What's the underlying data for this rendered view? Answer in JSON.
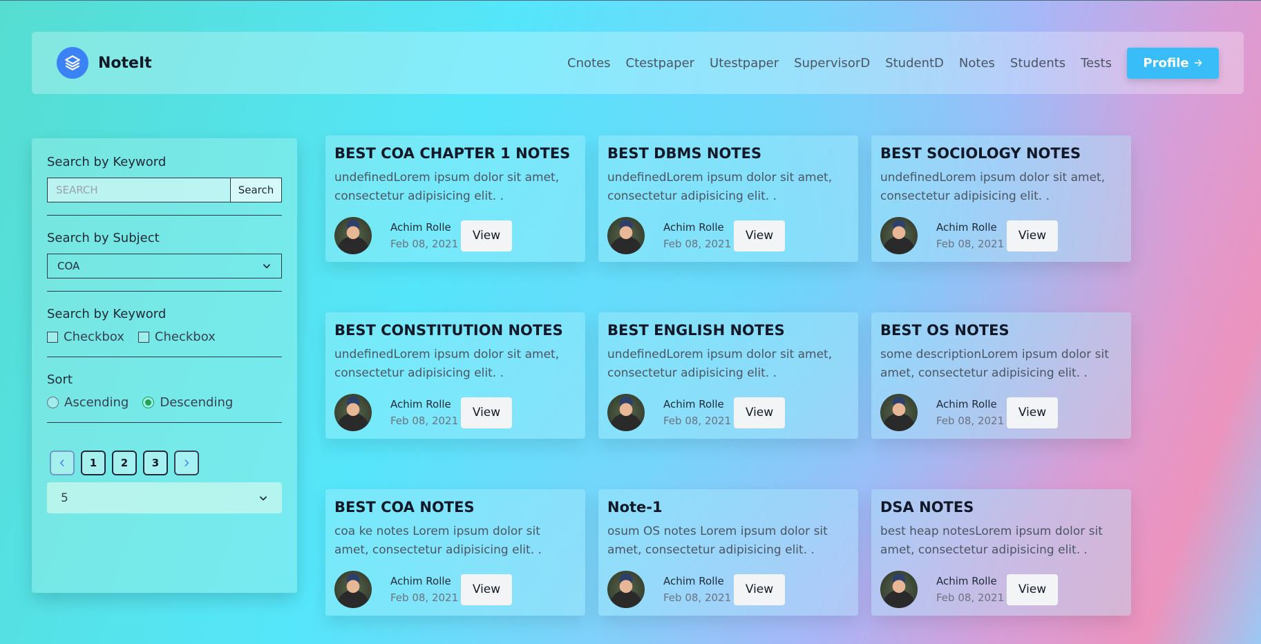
{
  "app": {
    "name": "NoteIt",
    "logo_icon": "layers-icon"
  },
  "nav": {
    "links": [
      "Cnotes",
      "Ctestpaper",
      "Utestpaper",
      "SupervisorD",
      "StudentD",
      "Notes",
      "Students",
      "Tests"
    ],
    "profile_label": "Profile",
    "profile_icon": "arrow-right-icon"
  },
  "sidebar": {
    "keyword": {
      "title": "Search by Keyword",
      "placeholder": "SEARCH",
      "value": "",
      "button": "Search"
    },
    "subject": {
      "title": "Search by Subject",
      "selected": "COA"
    },
    "keyword2": {
      "title": "Search by Keyword",
      "checkboxes": [
        "Checkbox",
        "Checkbox"
      ]
    },
    "sort": {
      "title": "Sort",
      "options": [
        "Ascending",
        "Descending"
      ],
      "selected": "Descending"
    },
    "pagination": {
      "pages": [
        "1",
        "2",
        "3"
      ]
    },
    "per_page": "5"
  },
  "colors": {
    "primary": "#38bdf8",
    "logo": "#3b82f6",
    "radio_checked": "#22a354"
  },
  "cards": [
    {
      "title": "BEST COA CHAPTER 1 NOTES",
      "desc": "undefinedLorem ipsum dolor sit amet, consectetur adipisicing elit. .",
      "author": "Achim Rolle",
      "date": "Feb 08, 2021",
      "button": "View"
    },
    {
      "title": "BEST DBMS NOTES",
      "desc": "undefinedLorem ipsum dolor sit amet, consectetur adipisicing elit. .",
      "author": "Achim Rolle",
      "date": "Feb 08, 2021",
      "button": "View"
    },
    {
      "title": "BEST SOCIOLOGY NOTES",
      "desc": "undefinedLorem ipsum dolor sit amet, consectetur adipisicing elit. .",
      "author": "Achim Rolle",
      "date": "Feb 08, 2021",
      "button": "View"
    },
    {
      "title": "BEST CONSTITUTION NOTES",
      "desc": "undefinedLorem ipsum dolor sit amet, consectetur adipisicing elit. .",
      "author": "Achim Rolle",
      "date": "Feb 08, 2021",
      "button": "View"
    },
    {
      "title": "BEST ENGLISH NOTES",
      "desc": "undefinedLorem ipsum dolor sit amet, consectetur adipisicing elit. .",
      "author": "Achim Rolle",
      "date": "Feb 08, 2021",
      "button": "View"
    },
    {
      "title": "BEST OS NOTES",
      "desc": "some descriptionLorem ipsum dolor sit amet, consectetur adipisicing elit. .",
      "author": "Achim Rolle",
      "date": "Feb 08, 2021",
      "button": "View"
    },
    {
      "title": "BEST COA NOTES",
      "desc": "coa ke notes Lorem ipsum dolor sit amet, consectetur adipisicing elit. .",
      "author": "Achim Rolle",
      "date": "Feb 08, 2021",
      "button": "View"
    },
    {
      "title": "Note-1",
      "desc": "osum OS notes Lorem ipsum dolor sit amet, consectetur adipisicing elit. .",
      "author": "Achim Rolle",
      "date": "Feb 08, 2021",
      "button": "View"
    },
    {
      "title": "DSA NOTES",
      "desc": "best heap notesLorem ipsum dolor sit amet, consectetur adipisicing elit. .",
      "author": "Achim Rolle",
      "date": "Feb 08, 2021",
      "button": "View"
    }
  ]
}
